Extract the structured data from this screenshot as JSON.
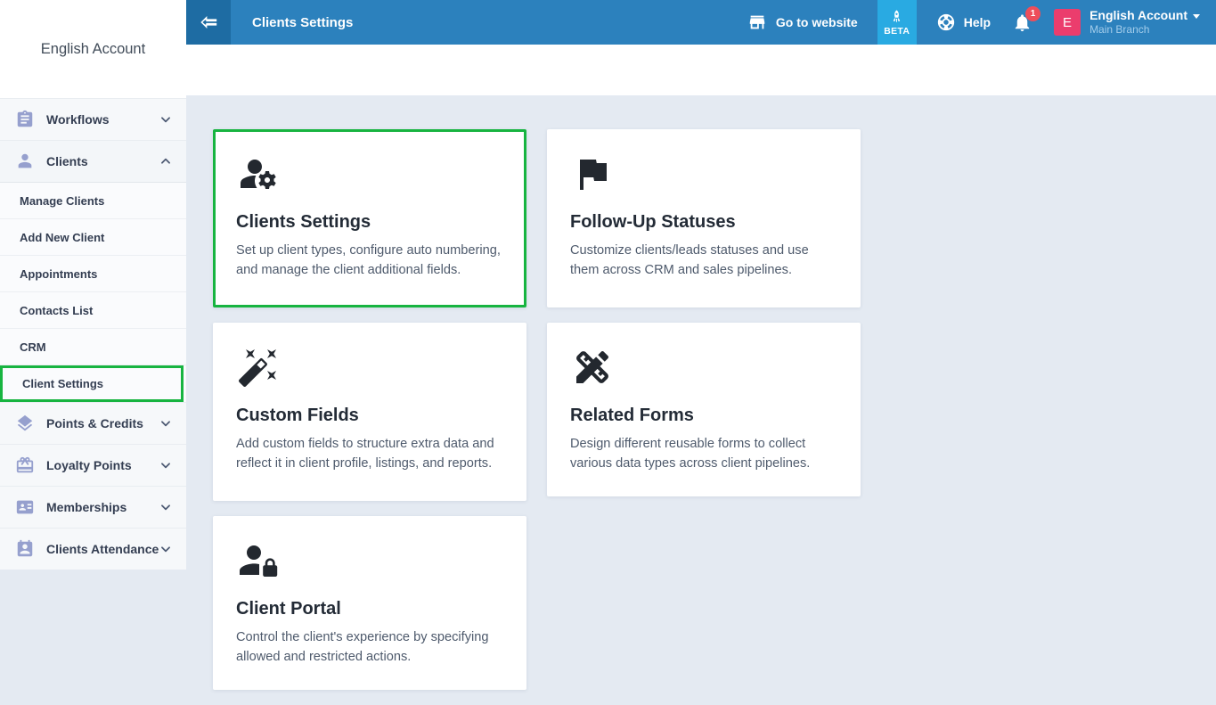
{
  "colors": {
    "header_bg": "#2c81bd",
    "header_dark_square": "#1e6ca3",
    "beta_bg": "#29aae2",
    "notification_badge_bg": "#ee4e5a",
    "avatar_bg": "#eb3d6d",
    "highlight_green": "#17b440",
    "content_bg": "#e4eaf2",
    "sidebar_icon": "#96a0ce"
  },
  "topbar": {
    "title": "Clients Settings",
    "go_to_website_label": "Go to website",
    "beta_label": "BETA",
    "help_label": "Help",
    "notification_count": "1",
    "avatar_initial": "E",
    "account_name": "English Account",
    "branch_name": "Main Branch"
  },
  "sidebar": {
    "account_name": "English Account",
    "items": [
      {
        "label": "Workflows",
        "icon": "clipboard-icon",
        "expanded": false
      },
      {
        "label": "Clients",
        "icon": "person-icon",
        "expanded": true,
        "children": [
          {
            "label": "Manage Clients"
          },
          {
            "label": "Add New Client"
          },
          {
            "label": "Appointments"
          },
          {
            "label": "Contacts List"
          },
          {
            "label": "CRM"
          },
          {
            "label": "Client Settings",
            "highlighted": true
          }
        ]
      },
      {
        "label": "Points & Credits",
        "icon": "layers-icon",
        "expanded": false
      },
      {
        "label": "Loyalty Points",
        "icon": "gift-icon",
        "expanded": false
      },
      {
        "label": "Memberships",
        "icon": "id-card-icon",
        "expanded": false
      },
      {
        "label": "Clients Attendance",
        "icon": "calendar-person-icon",
        "expanded": false
      }
    ]
  },
  "cards": [
    {
      "title": "Clients Settings",
      "description": "Set up client types, configure auto numbering, and manage the client additional fields.",
      "icon": "person-gear-icon",
      "highlighted": true
    },
    {
      "title": "Follow-Up Statuses",
      "description": "Customize clients/leads statuses and use them across CRM and sales pipelines.",
      "icon": "flag-icon",
      "highlighted": false
    },
    {
      "title": "Custom Fields",
      "description": "Add custom fields to structure extra data and reflect it in client profile, listings, and reports.",
      "icon": "magic-wand-icon",
      "highlighted": false
    },
    {
      "title": "Related Forms",
      "description": "Design different reusable forms to collect various data types across client pipelines.",
      "icon": "design-services-icon",
      "highlighted": false
    },
    {
      "title": "Client Portal",
      "description": "Control the client's experience by specifying allowed and restricted actions.",
      "icon": "person-lock-icon",
      "highlighted": false
    }
  ]
}
